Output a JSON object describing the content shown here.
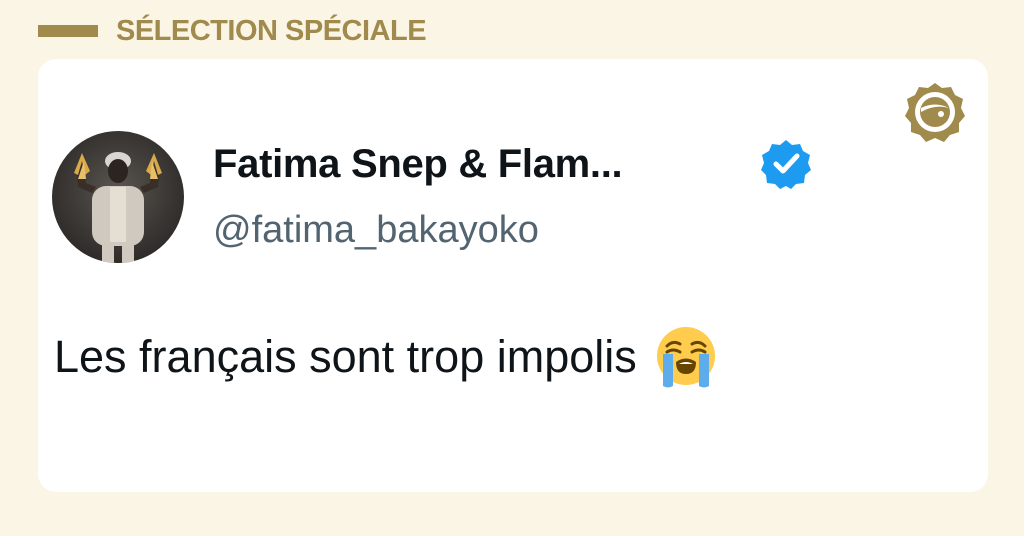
{
  "section": {
    "title": "SÉLECTION SPÉCIALE"
  },
  "tweet": {
    "author_name": "Fatima Snep & Flam...",
    "handle": "@fatima_bakayoko",
    "verified": true,
    "text": "Les français sont trop impolis",
    "emoji": "loudly-crying-face-icon"
  },
  "colors": {
    "page_background": "#fbf5e6",
    "accent_gold": "#a08a4c",
    "card_background": "#ffffff",
    "verified_blue": "#1d9bf0",
    "text_primary": "#0f1419",
    "text_secondary": "#536471"
  }
}
